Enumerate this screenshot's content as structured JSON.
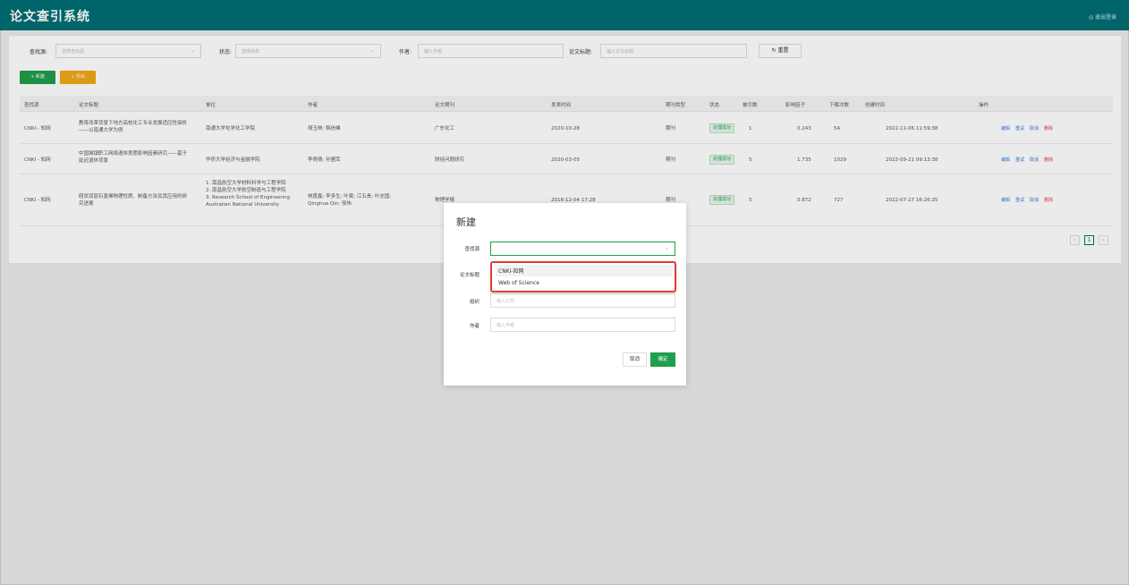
{
  "header": {
    "title": "论文查引系统",
    "logout": "退出登录",
    "logout_icon": "user-icon"
  },
  "filters": {
    "source_label": "查找源:",
    "source_placeholder": "选择查找源",
    "status_label": "状态:",
    "status_placeholder": "选择状态",
    "author_label": "作者:",
    "author_placeholder": "输入作者",
    "title_label": "论文标题:",
    "title_placeholder": "输入论文标题",
    "reset_label": "重置",
    "reset_icon": "refresh-icon"
  },
  "toolbar": {
    "new_label": "+ 新建",
    "export_label": "↓ 导出"
  },
  "table": {
    "columns": [
      "查找源",
      "论文标题",
      "单位",
      "作者",
      "论文期刊",
      "发表时间",
      "期刊类型",
      "状态",
      "被引数",
      "影响因子",
      "下载次数",
      "创建时间",
      "操作"
    ],
    "rows": [
      {
        "source": "CNKI - 知网",
        "title": "教育改革背景下地方高校化工专业发展适应性探析——以南通大学为例",
        "unit": "南通大学化学化工学院",
        "authors": "胡玉林; 韩信峰",
        "journal": "广东化工",
        "date": "2020-10-28",
        "type": "期刊",
        "status": "处理成功",
        "cited": "1",
        "impact": "0.243",
        "downloads": "54",
        "created": "2022-11-06 11:59:38"
      },
      {
        "source": "CNKI - 知网",
        "title": "中国城镇职工网络退休意愿影响因素研究——基于延迟退休背景",
        "unit": "华侨大学经济与金融学院",
        "authors": "李倩倩; 孙圃军",
        "journal": "财经问题研究",
        "date": "2020-03-05",
        "type": "期刊",
        "status": "处理成功",
        "cited": "5",
        "impact": "1.735",
        "downloads": "1029",
        "created": "2022-09-21 09:13:38"
      },
      {
        "source": "CNKI - 知网",
        "title": "纽状双层石墨烯物理性质、制备方法及其应用的研究进展",
        "unit_lines": [
          "1. 南昌航空大学材料科学与工程学院",
          "2. 南昌航空大学航空制造与工程学院",
          "3. Research School of Engineering",
          "Australian National University"
        ],
        "authors_lines": [
          "林度鑫; 李多生; 叶寅; 江五贵; 叶志国;",
          "Qinghua Qin; 邬伟"
        ],
        "journal": "物理学报",
        "date": "2018-12-04 17:28",
        "type": "期刊",
        "status": "处理成功",
        "cited": "5",
        "impact": "0.872",
        "downloads": "727",
        "created": "2022-07-27 16:26:25"
      }
    ],
    "actions": [
      "编辑",
      "重试",
      "取消",
      "删除"
    ]
  },
  "pagination": {
    "prev": "‹",
    "current": "1",
    "next": "›"
  },
  "modal": {
    "title": "新建",
    "source_label": "查找源",
    "title_label": "论文标题",
    "org_label": "组织",
    "org_placeholder": "输入公司",
    "author_label": "作者",
    "author_placeholder": "输入作者",
    "cancel_label": "取消",
    "ok_label": "确定",
    "dropdown_options": [
      "CNKI-知网",
      "Web of Science"
    ]
  },
  "colors": {
    "header_bg": "#006e74",
    "primary_green": "#1f9e4d",
    "export_orange": "#f0a817",
    "highlight_red": "#e53935"
  }
}
